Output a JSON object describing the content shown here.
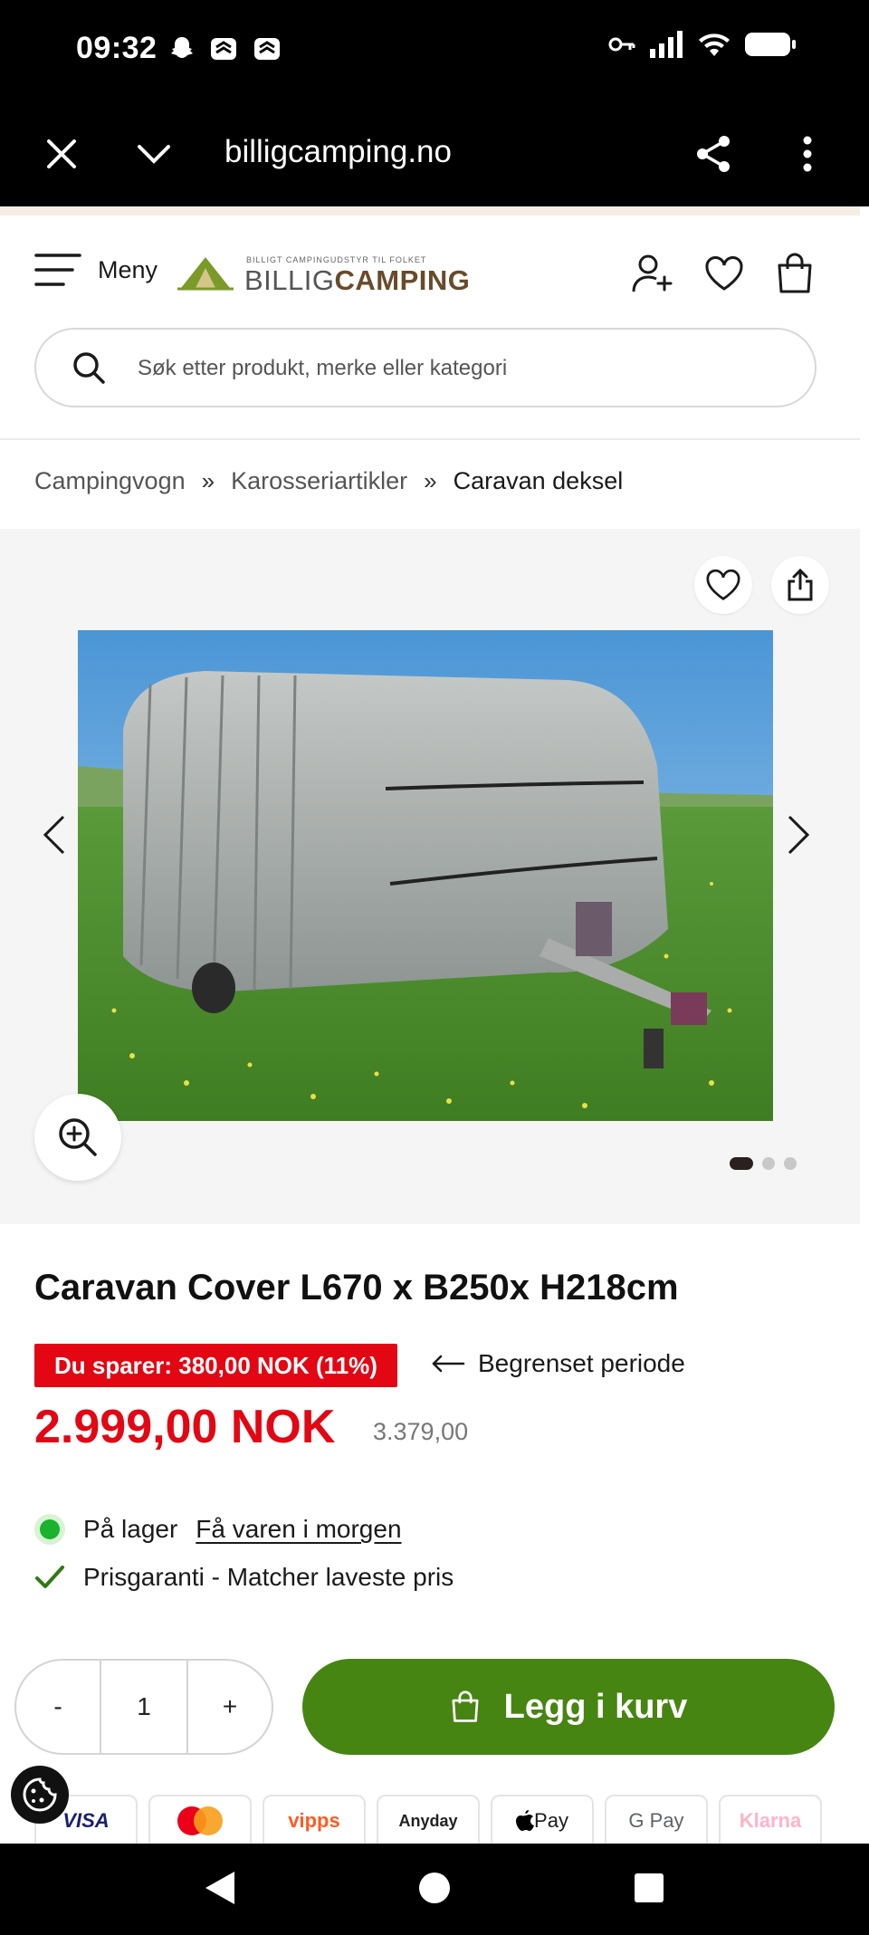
{
  "status_bar": {
    "time": "09:32"
  },
  "browser": {
    "url": "billigcamping.no"
  },
  "header": {
    "menu_label": "Meny",
    "logo_tagline": "BILLIGT CAMPINGUDSTYR TIL FOLKET",
    "logo_brand_light": "BILLIG",
    "logo_brand_bold": "CAMPING"
  },
  "search": {
    "placeholder": "Søk etter produkt, merke eller kategori"
  },
  "breadcrumb": {
    "items": [
      "Campingvogn",
      "Karosseriartikler",
      "Caravan deksel"
    ],
    "separator": "»"
  },
  "gallery": {
    "image_count": 3,
    "active_index": 0
  },
  "product": {
    "title": "Caravan Cover L670 x B250x H218cm",
    "savings": "Du sparer: 380,00 NOK (11%)",
    "period_note": "Begrenset periode",
    "price": "2.999,00 NOK",
    "old_price": "3.379,00",
    "stock_status": "På lager",
    "delivery_link": "Få varen i morgen",
    "price_guarantee": "Prisgaranti - Matcher laveste pris"
  },
  "cart": {
    "decrement": "-",
    "quantity": "1",
    "increment": "+",
    "add_label": "Legg i kurv"
  },
  "payments": [
    "VISA",
    "Mastercard",
    "vipps",
    "Anyday",
    "Pay",
    "G Pay",
    "Klarna"
  ],
  "colors": {
    "brand_green": "#478512",
    "sale_red": "#e30613",
    "stock_green": "#19b32e"
  }
}
